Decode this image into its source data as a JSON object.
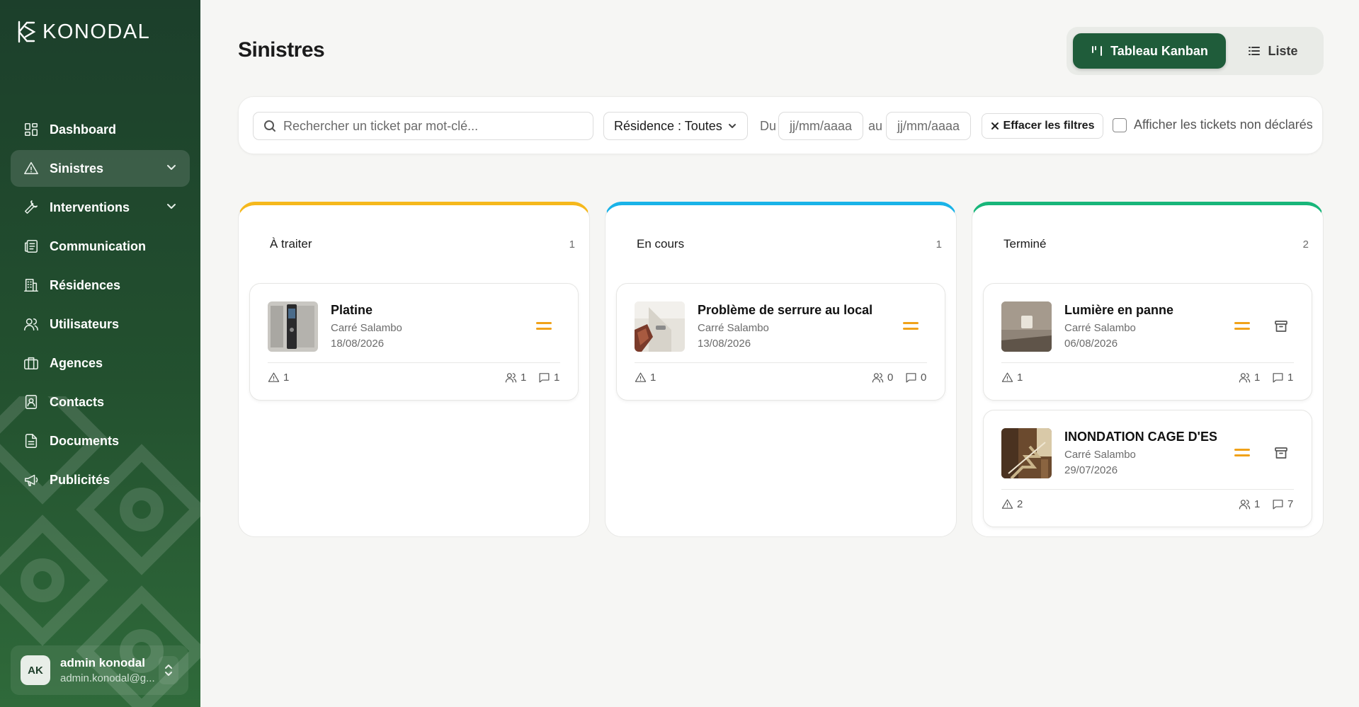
{
  "app": {
    "brand": "KONODAL"
  },
  "sidebar": {
    "items": [
      {
        "label": "Dashboard",
        "icon": "dashboard-icon"
      },
      {
        "label": "Sinistres",
        "icon": "warning-icon"
      },
      {
        "label": "Interventions",
        "icon": "wrench-icon"
      },
      {
        "label": "Communication",
        "icon": "newspaper-icon"
      },
      {
        "label": "Résidences",
        "icon": "building-icon"
      },
      {
        "label": "Utilisateurs",
        "icon": "users-icon"
      },
      {
        "label": "Agences",
        "icon": "briefcase-icon"
      },
      {
        "label": "Contacts",
        "icon": "contact-icon"
      },
      {
        "label": "Documents",
        "icon": "document-icon"
      },
      {
        "label": "Publicités",
        "icon": "megaphone-icon"
      }
    ],
    "user": {
      "initials": "AK",
      "name": "admin konodal",
      "email": "admin.konodal@g..."
    }
  },
  "header": {
    "title": "Sinistres",
    "view_kanban": "Tableau Kanban",
    "view_list": "Liste"
  },
  "filters": {
    "search_placeholder": "Rechercher un ticket par mot-clé...",
    "residence": "Résidence : Toutes",
    "from_label": "Du",
    "to_label": "au",
    "date_placeholder": "jj/mm/aaaa",
    "clear_label": "Effacer les filtres",
    "undeclared_label": "Afficher les tickets non déclarés"
  },
  "columns": [
    {
      "title": "À traiter",
      "count": "1",
      "color": "#f5b81c",
      "tickets": [
        {
          "title": "Platine",
          "residence": "Carré Salambo",
          "date": "18/08/2026",
          "incidents": "1",
          "users": "1",
          "comments": "1",
          "archivable": false
        }
      ]
    },
    {
      "title": "En cours",
      "count": "1",
      "color": "#1ab3e8",
      "tickets": [
        {
          "title": "Problème de serrure au local",
          "residence": "Carré Salambo",
          "date": "13/08/2026",
          "incidents": "1",
          "users": "0",
          "comments": "0",
          "archivable": false
        }
      ]
    },
    {
      "title": "Terminé",
      "count": "2",
      "color": "#18b67a",
      "tickets": [
        {
          "title": "Lumière en panne",
          "residence": "Carré Salambo",
          "date": "06/08/2026",
          "incidents": "1",
          "users": "1",
          "comments": "1",
          "archivable": true
        },
        {
          "title": "INONDATION CAGE D'ES...",
          "residence": "Carré Salambo",
          "date": "29/07/2026",
          "incidents": "2",
          "users": "1",
          "comments": "7",
          "archivable": true
        }
      ]
    }
  ],
  "colors": {
    "sidebar": "#1c3f2b",
    "primary": "#1f5c3a",
    "priority": "#f0a21a"
  }
}
